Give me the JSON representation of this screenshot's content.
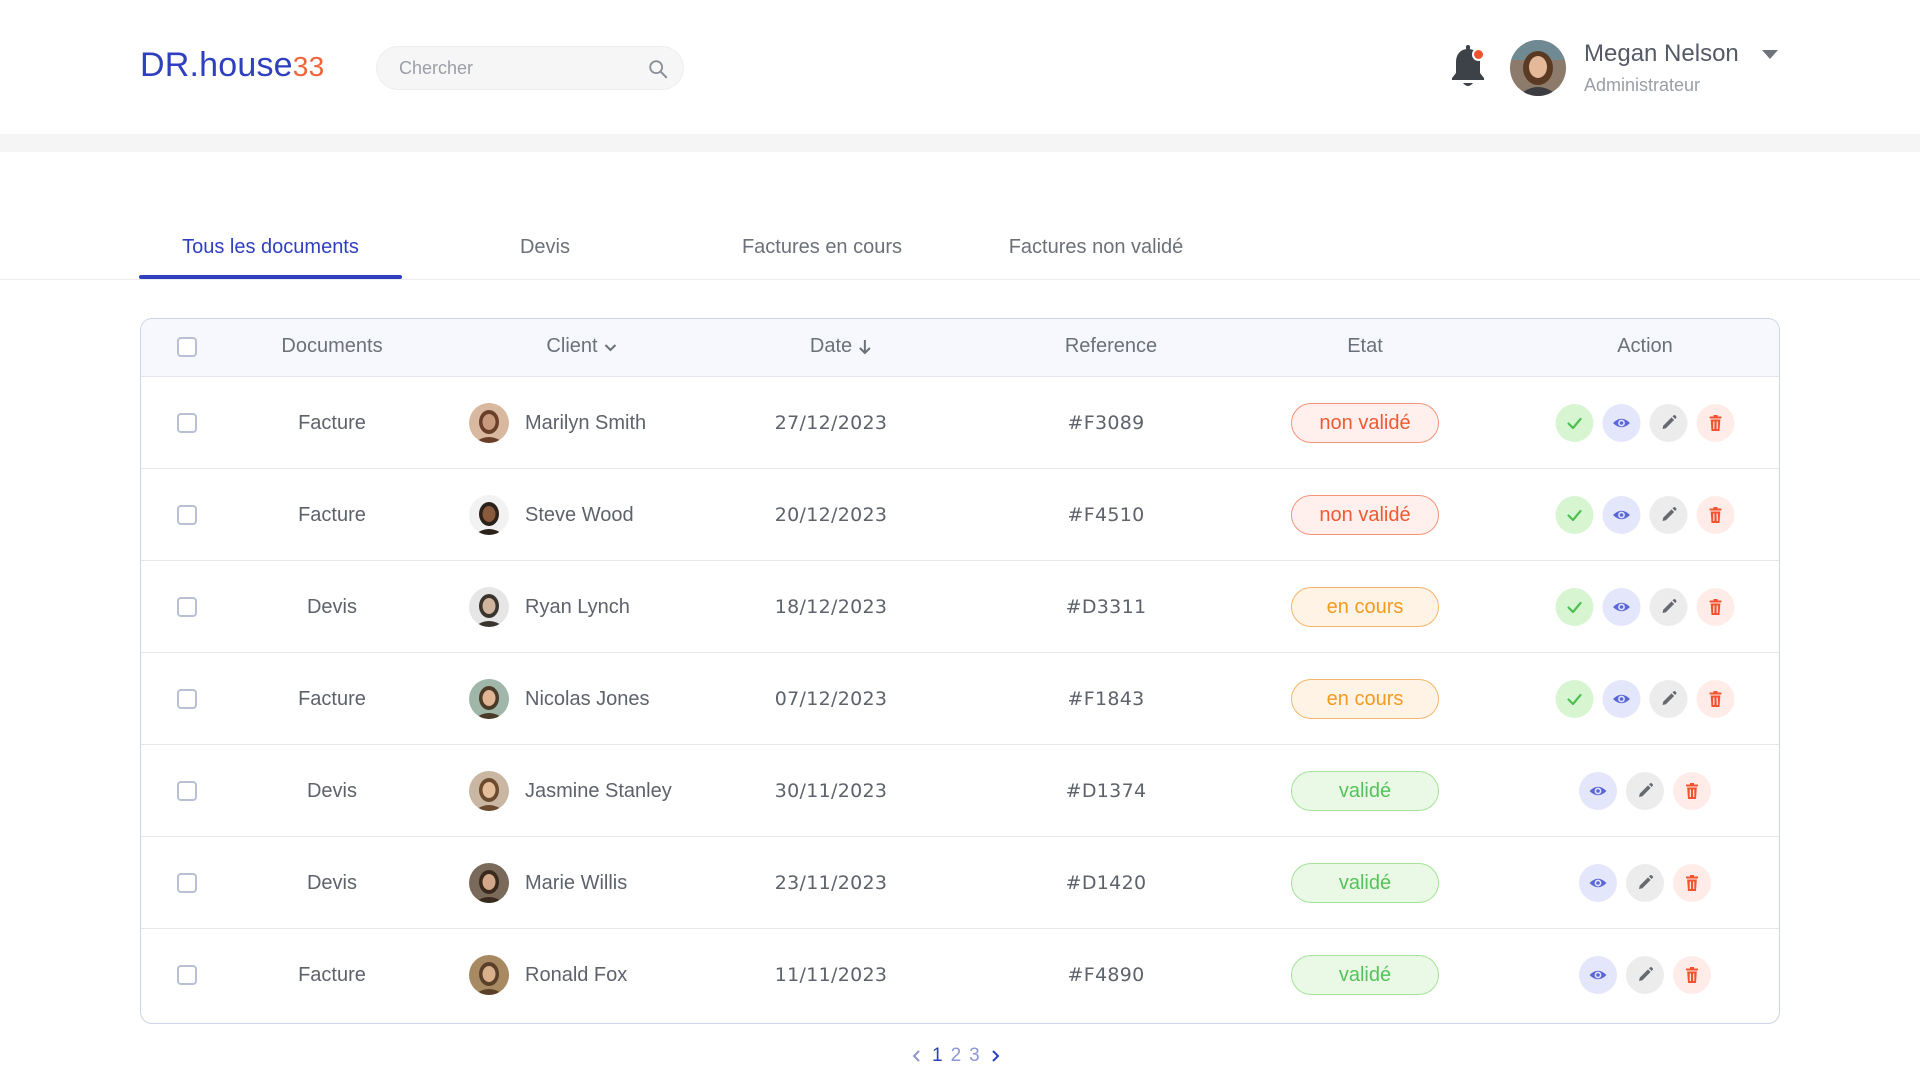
{
  "brand": {
    "name": "DR.house",
    "number": "33"
  },
  "search": {
    "placeholder": "Chercher"
  },
  "user": {
    "name": "Megan Nelson",
    "role": "Administrateur"
  },
  "tabs": [
    {
      "label": "Tous les documents",
      "active": true
    },
    {
      "label": "Devis",
      "active": false
    },
    {
      "label": "Factures en cours",
      "active": false
    },
    {
      "label": "Factures non validé",
      "active": false
    }
  ],
  "table": {
    "headers": {
      "documents": "Documents",
      "client": "Client",
      "date": "Date",
      "reference": "Reference",
      "etat": "Etat",
      "action": "Action"
    },
    "rows": [
      {
        "document": "Facture",
        "client": "Marilyn Smith",
        "date": "27/12/2023",
        "reference": "#F3089",
        "etat": "non validé",
        "status": "invalid"
      },
      {
        "document": "Facture",
        "client": "Steve Wood",
        "date": "20/12/2023",
        "reference": "#F4510",
        "etat": "non validé",
        "status": "invalid"
      },
      {
        "document": "Devis",
        "client": "Ryan Lynch",
        "date": "18/12/2023",
        "reference": "#D3311",
        "etat": "en cours",
        "status": "pending"
      },
      {
        "document": "Facture",
        "client": "Nicolas Jones",
        "date": "07/12/2023",
        "reference": "#F1843",
        "etat": "en cours",
        "status": "pending"
      },
      {
        "document": "Devis",
        "client": "Jasmine Stanley",
        "date": "30/11/2023",
        "reference": "#D1374",
        "etat": "validé",
        "status": "valid"
      },
      {
        "document": "Devis",
        "client": "Marie Willis",
        "date": "23/11/2023",
        "reference": "#D1420",
        "etat": "validé",
        "status": "valid"
      },
      {
        "document": "Facture",
        "client": "Ronald Fox",
        "date": "11/11/2023",
        "reference": "#F4890",
        "etat": "validé",
        "status": "valid"
      }
    ]
  },
  "pagination": {
    "pages": [
      "1",
      "2",
      "3"
    ],
    "current": "1"
  },
  "colors": {
    "accent": "#2f3fbf",
    "brand_number": "#f0643b",
    "invalid_text": "#f05a32",
    "invalid_bg": "#fff0ed",
    "invalid_border": "#f3937a",
    "pending_text": "#f39a1f",
    "pending_bg": "#fff3e6",
    "pending_border": "#f5b56a",
    "valid_text": "#55c35a",
    "valid_bg": "#e9f9e5",
    "valid_border": "#a5e39b",
    "approve_bg": "#d8f5d2",
    "approve_fg": "#4cc152",
    "view_bg": "#e4e6fb",
    "view_fg": "#5a67d8",
    "edit_bg": "#ececec",
    "edit_fg": "#666a70",
    "delete_bg": "#ffece8",
    "delete_fg": "#f0532e"
  },
  "icons": {
    "search": "search-icon",
    "bell": "bell-icon",
    "caret": "caret-down-icon",
    "approve": "check-icon",
    "view": "eye-icon",
    "edit": "pencil-icon",
    "delete": "trash-icon"
  }
}
